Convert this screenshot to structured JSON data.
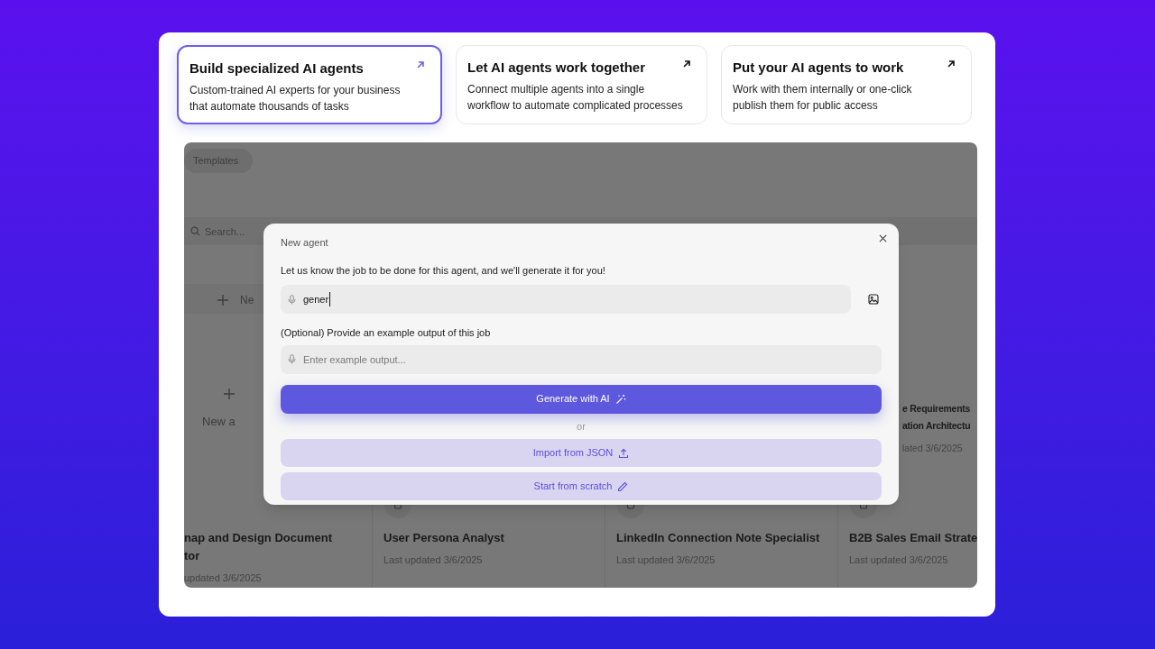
{
  "feature_cards": [
    {
      "title": "Build specialized AI agents",
      "description": "Custom-trained AI experts for your business that automate thousands of tasks",
      "selected": true
    },
    {
      "title": "Let AI agents work together",
      "description": "Connect multiple agents into a single workflow to automate complicated processes",
      "selected": false
    },
    {
      "title": "Put your AI agents to work",
      "description": "Work with them internally or one-click publish them for public access",
      "selected": false
    }
  ],
  "templates_tab": "Templates",
  "search": {
    "placeholder": "Search..."
  },
  "new_row_label": "Ne",
  "new_card_label": "New a",
  "side_card": {
    "title_lines": [
      "e Requirements",
      "ation Architectu"
    ],
    "updated": "lated 3/6/2025"
  },
  "agent_cards": [
    {
      "title_lines": [
        "nap and Design Document",
        "tor"
      ],
      "updated": "updated 3/6/2025"
    },
    {
      "title_lines": [
        "User Persona Analyst"
      ],
      "updated": "Last updated 3/6/2025"
    },
    {
      "title_lines": [
        "LinkedIn Connection Note Specialist"
      ],
      "updated": "Last updated 3/6/2025"
    },
    {
      "title_lines": [
        "B2B Sales Email Strate"
      ],
      "updated": "Last updated 3/6/2025"
    }
  ],
  "modal": {
    "title": "New agent",
    "prompt_label": "Let us know the job to be done for this agent, and we'll generate it for you!",
    "prompt_value": "gener",
    "example_label": "(Optional) Provide an example output of this job",
    "example_placeholder": "Enter example output...",
    "generate_button": "Generate with AI",
    "divider": "or",
    "import_button": "Import from JSON",
    "scratch_button": "Start from scratch"
  }
}
